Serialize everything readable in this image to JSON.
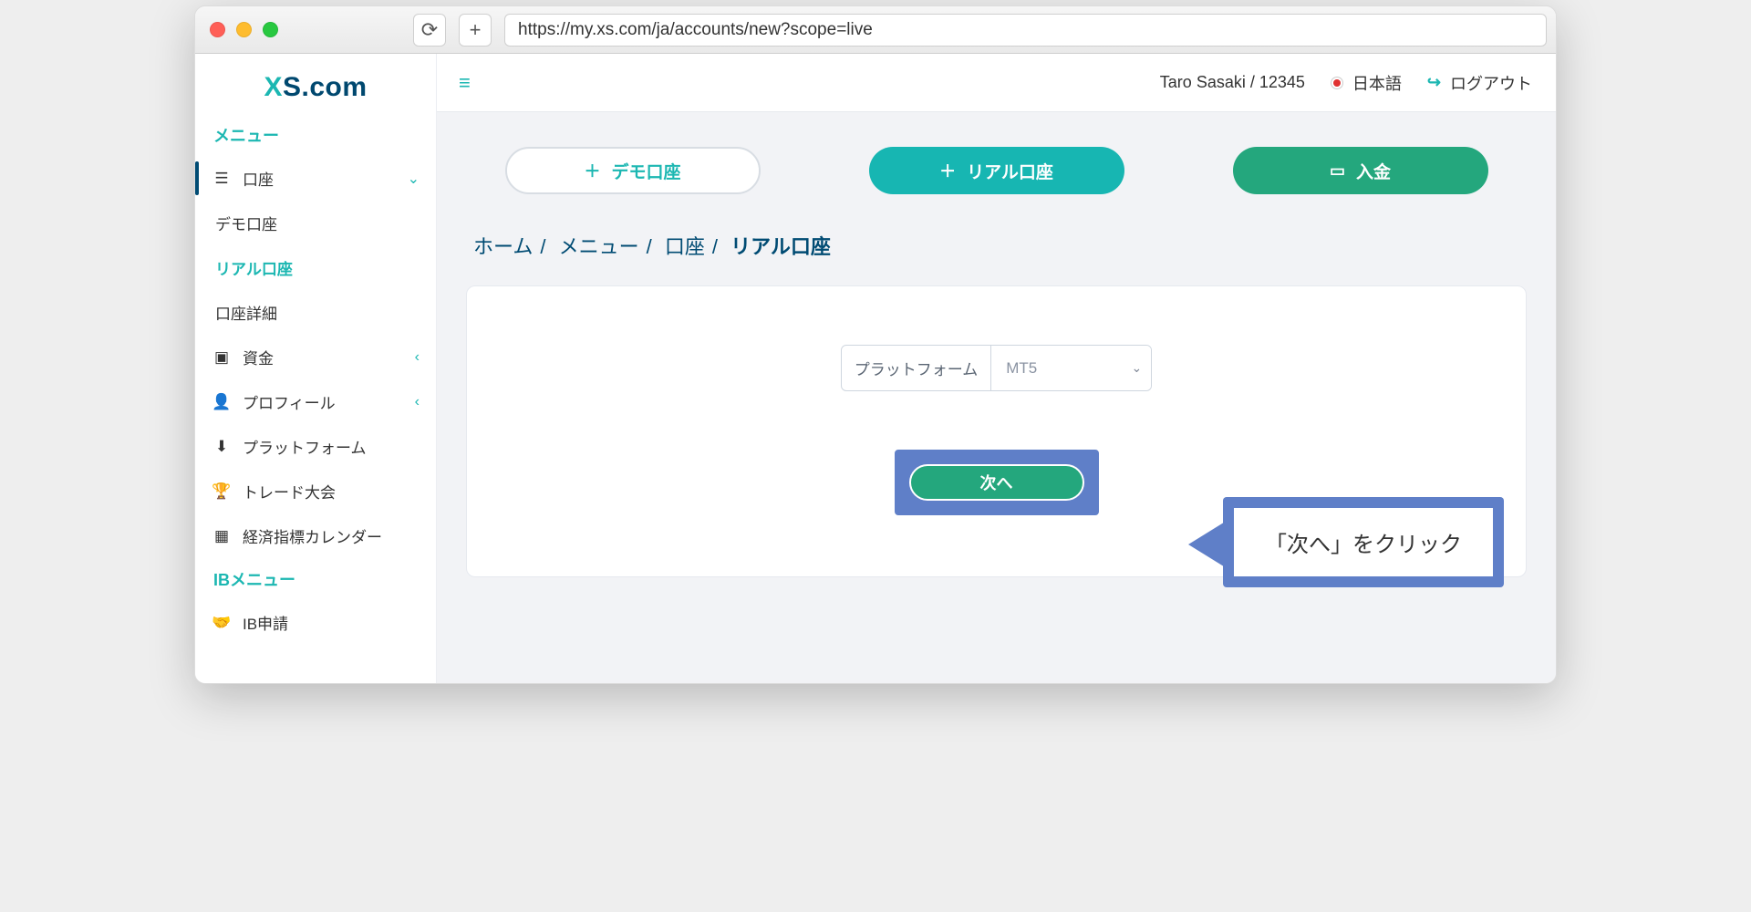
{
  "browser": {
    "url": "https://my.xs.com/ja/accounts/new?scope=live"
  },
  "logo": {
    "x": "X",
    "s": "S",
    "com": ".com"
  },
  "sidebar": {
    "section_main": "メニュー",
    "accounts": "口座",
    "demo": "デモ口座",
    "live": "リアル口座",
    "detail": "口座詳細",
    "funds": "資金",
    "profile": "プロフィール",
    "platforms": "プラットフォーム",
    "contest": "トレード大会",
    "calendar": "経済指標カレンダー",
    "section_ib": "IBメニュー",
    "ib_apply": "IB申請"
  },
  "topbar": {
    "user": "Taro Sasaki / 12345",
    "language": "日本語",
    "logout": "ログアウト"
  },
  "actions": {
    "demo": "デモ口座",
    "live": "リアル口座",
    "deposit": "入金"
  },
  "breadcrumbs": {
    "home": "ホーム",
    "menu": "メニュー",
    "accounts": "口座",
    "current": "リアル口座"
  },
  "form": {
    "platform_label": "プラットフォーム",
    "platform_value": "MT5",
    "next": "次へ"
  },
  "callout": "「次へ」をクリック"
}
